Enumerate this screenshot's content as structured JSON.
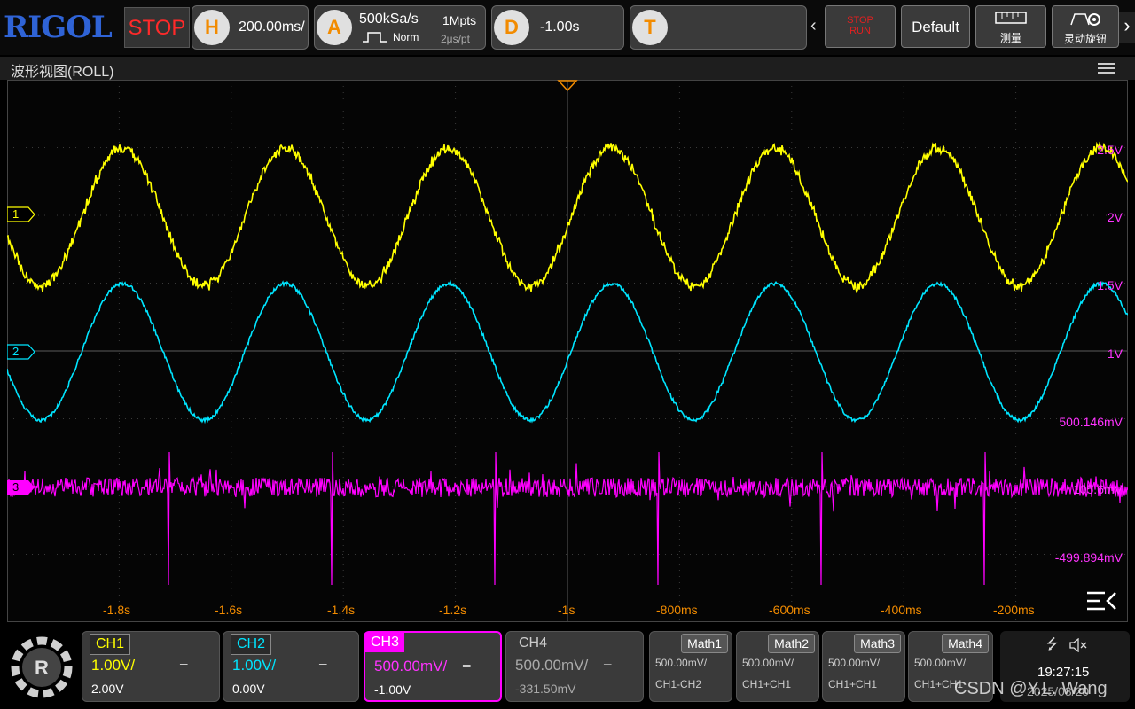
{
  "topbar": {
    "logo": "RIGOL",
    "run_state": "STOP",
    "horizontal": {
      "badge": "H",
      "value": "200.00ms/"
    },
    "acquire": {
      "badge": "A",
      "rate": "500kSa/s",
      "depth": "1Mpts",
      "mode": "Norm",
      "time_per_point": "2μs/pt"
    },
    "delay": {
      "badge": "D",
      "value": "-1.00s"
    },
    "trigger": {
      "badge": "T",
      "value": ""
    },
    "stop_run": {
      "line1": "STOP",
      "line2": "RUN"
    },
    "default_label": "Default",
    "measure_label": "测量",
    "knob_label": "灵动旋钮"
  },
  "titlebar": {
    "title": "波形视图(ROLL)"
  },
  "screen": {
    "time_labels": [
      "-1.8s",
      "-1.6s",
      "-1.4s",
      "-1.2s",
      "-1s",
      "-800ms",
      "-600ms",
      "-400ms",
      "-200ms"
    ],
    "volt_labels": [
      "2.5V",
      "2V",
      "1.5V",
      "1V",
      "500.146mV",
      "105.6mV",
      "-499.894mV"
    ],
    "markers": [
      "1",
      "2",
      "3"
    ]
  },
  "channels": [
    {
      "name": "CH1",
      "scale": "1.00V/",
      "offset": "2.00V",
      "color": "#ffff00"
    },
    {
      "name": "CH2",
      "scale": "1.00V/",
      "offset": "0.00V",
      "color": "#00e5ff"
    },
    {
      "name": "CH3",
      "scale": "500.00mV/",
      "offset": "-1.00V",
      "color": "#ff00ff"
    },
    {
      "name": "CH4",
      "scale": "500.00mV/",
      "offset": "-331.50mV",
      "color": "#aaaaaa"
    }
  ],
  "maths": [
    {
      "name": "Math1",
      "scale": "500.00mV/",
      "expr": "CH1-CH2"
    },
    {
      "name": "Math2",
      "scale": "500.00mV/",
      "expr": "CH1+CH1"
    },
    {
      "name": "Math3",
      "scale": "500.00mV/",
      "expr": "CH1+CH1"
    },
    {
      "name": "Math4",
      "scale": "500.00mV/",
      "expr": "CH1+CH1"
    }
  ],
  "status": {
    "time": "19:27:15",
    "date": "2025/03/20",
    "watermark": "CSDN @Y.L. Wang"
  }
}
